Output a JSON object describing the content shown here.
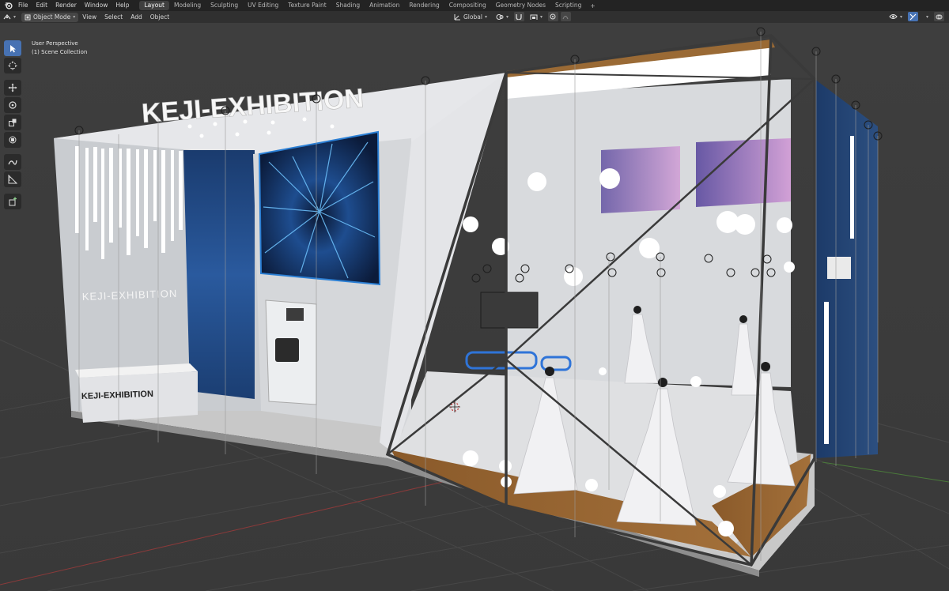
{
  "menu": {
    "items": [
      "File",
      "Edit",
      "Render",
      "Window",
      "Help"
    ]
  },
  "workspaces": [
    "Layout",
    "Modeling",
    "Sculpting",
    "UV Editing",
    "Texture Paint",
    "Shading",
    "Animation",
    "Rendering",
    "Compositing",
    "Geometry Nodes",
    "Scripting"
  ],
  "active_workspace": "Layout",
  "header": {
    "mode": "Object Mode",
    "view": "View",
    "select": "Select",
    "add": "Add",
    "object": "Object",
    "orientation": "Global"
  },
  "viewport": {
    "perspective": "User Perspective",
    "collection": "(1) Scene Collection"
  },
  "scene_text": {
    "header_sign": "KEJI-EXHIBITION",
    "wall_sign": "KEJI-EXHIBITION",
    "counter_sign": "KEJI-EXHIBITION"
  },
  "toolbar_tools": [
    "select-box",
    "cursor",
    "move",
    "rotate",
    "scale",
    "transform",
    "annotate",
    "measure",
    "add-cube"
  ],
  "colors": {
    "viewport_bg": "#3d3d3d",
    "accent": "#4772b3",
    "topbar": "#232323",
    "header": "#303030"
  }
}
